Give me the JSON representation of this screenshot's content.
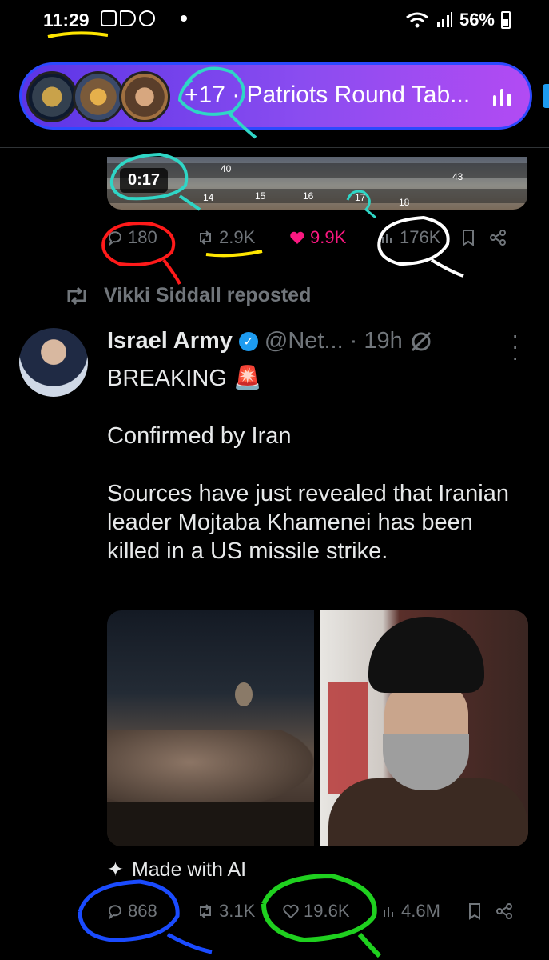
{
  "status_bar": {
    "time": "11:29",
    "battery": "56%"
  },
  "space": {
    "label": "+17 · Patriots Round Tab..."
  },
  "video": {
    "duration": "0:17",
    "seat_numbers": [
      "40",
      "14",
      "15",
      "16",
      "17",
      "18",
      "43"
    ]
  },
  "prev_tweet": {
    "replies": "180",
    "reposts": "2.9K",
    "likes": "9.9K",
    "views": "176K"
  },
  "repost": {
    "text": "Vikki Siddall reposted"
  },
  "tweet": {
    "name": "Israel Army",
    "handle": "@Net...",
    "time": "· 19h",
    "lines": [
      "BREAKING 🚨",
      "Confirmed by Iran",
      "Sources have just revealed that Iranian leader Mojtaba Khamenei has been killed in a US missile strike."
    ],
    "ai_label": "Made with AI",
    "replies": "868",
    "reposts": "3.1K",
    "likes": "19.6K",
    "views": "4.6M"
  },
  "colors": {
    "accent": "#1d9bf0",
    "like_active": "#f91880",
    "muted": "#71767b",
    "pill_start": "#5b35e6",
    "pill_end": "#b24bf3"
  }
}
